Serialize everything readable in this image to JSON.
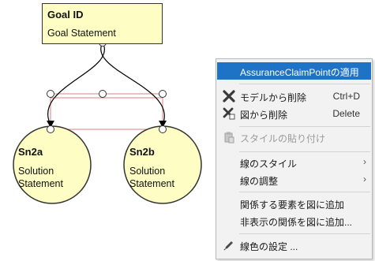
{
  "diagram": {
    "goal": {
      "id": "Goal ID",
      "statement": "Goal Statement"
    },
    "solutions": [
      {
        "id": "Sn2a",
        "line1": "Solution",
        "line2": "Statement"
      },
      {
        "id": "Sn2b",
        "line1": "Solution",
        "line2": "Statement"
      }
    ],
    "colors": {
      "node_fill": "#fdfdc4",
      "selection_handle": "#e08080",
      "edge": "#000000"
    }
  },
  "context_menu": {
    "items": [
      {
        "label": "AssuranceClaimPointの適用",
        "highlighted": true
      },
      {
        "label": "モデルから削除",
        "shortcut": "Ctrl+D",
        "icon": "delete-x-icon"
      },
      {
        "label": "図から削除",
        "shortcut": "Delete",
        "icon": "delete-x-small-icon"
      },
      {
        "label": "スタイルの貼り付け",
        "disabled": true,
        "icon": "paste-style-icon"
      },
      {
        "label": "線のスタイル",
        "submenu": "›"
      },
      {
        "label": "線の調整",
        "submenu": "›"
      },
      {
        "label": "関係する要素を図に追加"
      },
      {
        "label": "非表示の関係を図に追加..."
      },
      {
        "label": "線色の設定 ...",
        "icon": "pen-icon"
      }
    ],
    "colors": {
      "highlight": "#1e73c6",
      "background": "#f2f2f2"
    }
  }
}
